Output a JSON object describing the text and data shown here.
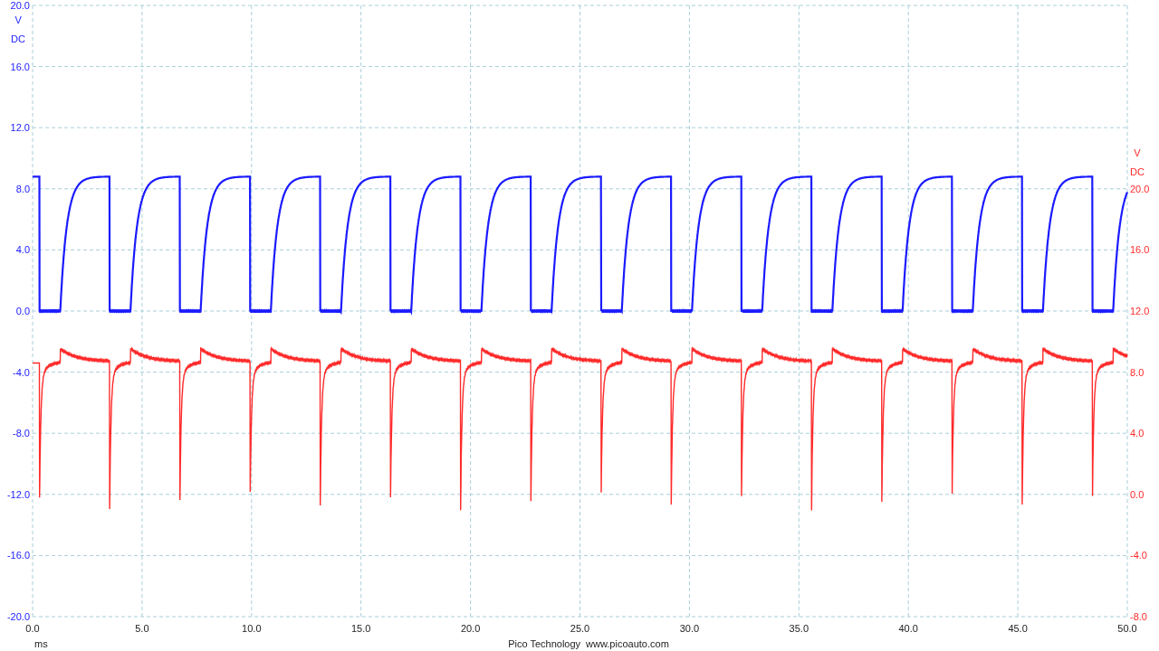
{
  "channels": [
    {
      "kind": "left",
      "color": "#1a1aff",
      "unit": "V",
      "coupling": "DC",
      "ticks": [
        "20.0",
        "16.0",
        "12.0",
        "8.0",
        "4.0",
        "0.0",
        "-4.0",
        "-8.0",
        "-12.0",
        "-16.0",
        "-20.0"
      ]
    },
    {
      "kind": "right",
      "color": "#ff2a2a",
      "unit": "V",
      "coupling": "DC",
      "ticks": [
        "20.0",
        "16.0",
        "12.0",
        "8.0",
        "4.0",
        "0.0",
        "-4.0",
        "-8.0"
      ]
    }
  ],
  "time_axis": {
    "unit": "ms",
    "ticks": [
      "0.0",
      "5.0",
      "10.0",
      "15.0",
      "20.0",
      "25.0",
      "30.0",
      "35.0",
      "40.0",
      "45.0",
      "50.0"
    ]
  },
  "footer": {
    "company": "Pico Technology",
    "website": "www.picoauto.com"
  }
}
